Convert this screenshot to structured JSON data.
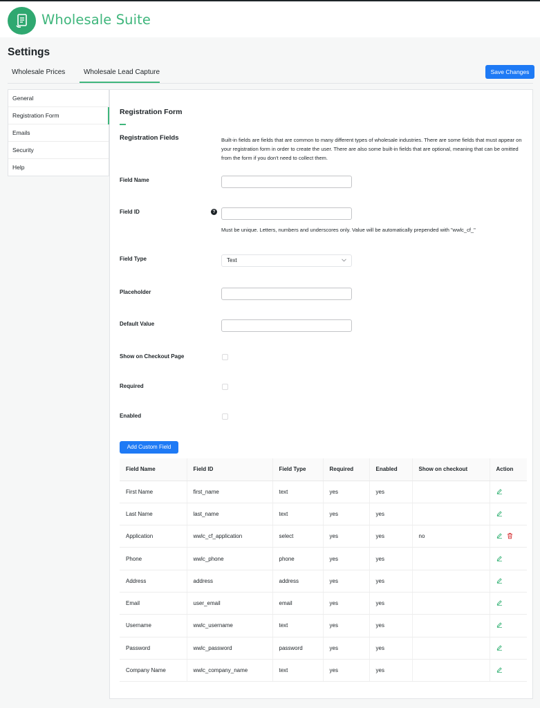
{
  "brand": {
    "name": "Wholesale Suite",
    "color": "#3fb67c"
  },
  "page": {
    "title": "Settings"
  },
  "tabs": [
    {
      "label": "Wholesale Prices",
      "active": false
    },
    {
      "label": "Wholesale Lead Capture",
      "active": true
    }
  ],
  "save_label": "Save Changes",
  "sidebar": {
    "items": [
      {
        "label": "General",
        "active": false
      },
      {
        "label": "Registration Form",
        "active": true
      },
      {
        "label": "Emails",
        "active": false
      },
      {
        "label": "Security",
        "active": false
      },
      {
        "label": "Help",
        "active": false
      }
    ]
  },
  "form": {
    "section_title": "Registration Form",
    "fields_title": "Registration Fields",
    "fields_description": "Built-in fields are fields that are common to many different types of wholesale industries. There are some fields that must appear on your registration form in order to create the user. There are also some built-in fields that are optional, meaning that can be omitted from the form if you don't need to collect them.",
    "field_name": {
      "label": "Field Name",
      "value": ""
    },
    "field_id": {
      "label": "Field ID",
      "value": "",
      "hint": "Must be unique. Letters, numbers and underscores only. Value will be automatically prepended with \"wwlc_cf_\""
    },
    "field_type": {
      "label": "Field Type",
      "value": "Text"
    },
    "placeholder": {
      "label": "Placeholder",
      "value": ""
    },
    "default_value": {
      "label": "Default Value",
      "value": ""
    },
    "show_on_checkout": {
      "label": "Show on Checkout Page",
      "checked": false
    },
    "required": {
      "label": "Required",
      "checked": false
    },
    "enabled": {
      "label": "Enabled",
      "checked": false
    },
    "add_button": "Add Custom Field"
  },
  "table": {
    "headers": [
      "Field Name",
      "Field ID",
      "Field Type",
      "Required",
      "Enabled",
      "Show on checkout",
      "Action"
    ],
    "rows": [
      {
        "name": "First Name",
        "id": "first_name",
        "type": "text",
        "required": "yes",
        "enabled": "yes",
        "checkout": "",
        "deletable": false
      },
      {
        "name": "Last Name",
        "id": "last_name",
        "type": "text",
        "required": "yes",
        "enabled": "yes",
        "checkout": "",
        "deletable": false
      },
      {
        "name": "Application",
        "id": "wwlc_cf_application",
        "type": "select",
        "required": "yes",
        "enabled": "yes",
        "checkout": "no",
        "deletable": true
      },
      {
        "name": "Phone",
        "id": "wwlc_phone",
        "type": "phone",
        "required": "yes",
        "enabled": "yes",
        "checkout": "",
        "deletable": false
      },
      {
        "name": "Address",
        "id": "address",
        "type": "address",
        "required": "yes",
        "enabled": "yes",
        "checkout": "",
        "deletable": false
      },
      {
        "name": "Email",
        "id": "user_email",
        "type": "email",
        "required": "yes",
        "enabled": "yes",
        "checkout": "",
        "deletable": false
      },
      {
        "name": "Username",
        "id": "wwlc_username",
        "type": "text",
        "required": "yes",
        "enabled": "yes",
        "checkout": "",
        "deletable": false
      },
      {
        "name": "Password",
        "id": "wwlc_password",
        "type": "password",
        "required": "yes",
        "enabled": "yes",
        "checkout": "",
        "deletable": false
      },
      {
        "name": "Company Name",
        "id": "wwlc_company_name",
        "type": "text",
        "required": "yes",
        "enabled": "yes",
        "checkout": "",
        "deletable": false
      }
    ]
  },
  "icons": {
    "edit": "pencil-icon",
    "delete": "trash-icon",
    "edit_color": "#3fb67c",
    "delete_color": "#d63638",
    "accent": "#1e7af5"
  }
}
